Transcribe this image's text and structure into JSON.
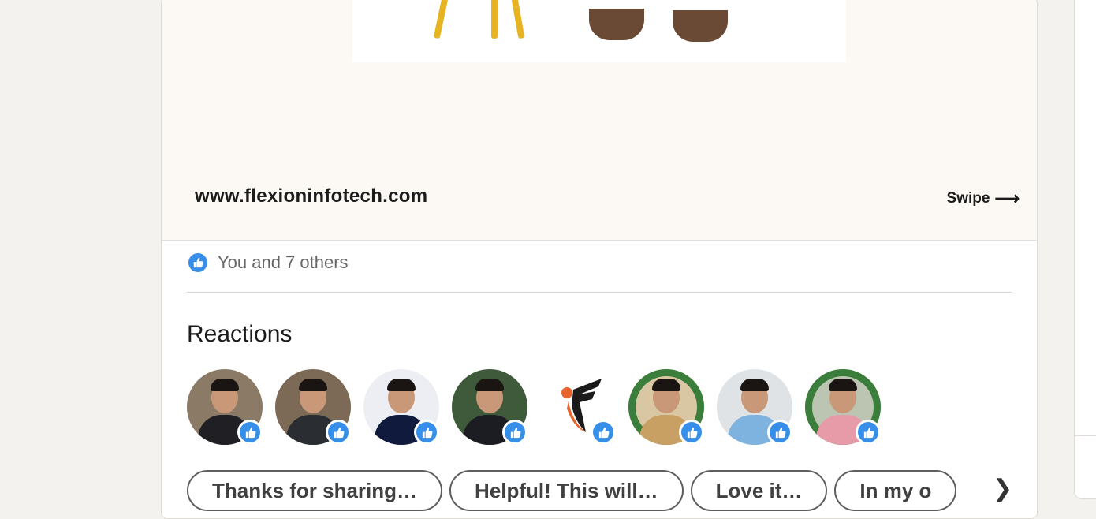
{
  "post": {
    "slide": {
      "website": "www.flexioninfotech.com",
      "swipe_label": "Swipe",
      "swipe_arrow": "⟶"
    },
    "social_counts": {
      "icon": "like-icon",
      "text": "You and 7 others"
    },
    "reactions": {
      "title": "Reactions",
      "reactors": [
        {
          "name": "reactor-1",
          "bg": "#8a7a66",
          "shirt": "#1f1f24",
          "badge": "like-icon"
        },
        {
          "name": "reactor-2",
          "bg": "#7c6a56",
          "shirt": "#2a2e33",
          "badge": "like-icon"
        },
        {
          "name": "reactor-3",
          "bg": "#eceef4",
          "shirt": "#101a3c",
          "badge": "like-icon"
        },
        {
          "name": "reactor-4",
          "bg": "#3e5a3a",
          "shirt": "#1c1d22",
          "badge": "like-icon"
        },
        {
          "name": "reactor-5-company-logo",
          "bg": "#ffffff",
          "shirt": "#ffffff",
          "badge": "like-icon"
        },
        {
          "name": "reactor-6-opentowork",
          "bg": "#d9c7a4",
          "shirt": "#c9a063",
          "badge": "like-icon",
          "ring": "#3b7d3a"
        },
        {
          "name": "reactor-7",
          "bg": "#dfe3e6",
          "shirt": "#7fb3df",
          "badge": "like-icon"
        },
        {
          "name": "reactor-8-opentowork",
          "bg": "#bcc4b2",
          "shirt": "#e79aa8",
          "badge": "like-icon",
          "ring": "#3b7d3a"
        }
      ]
    },
    "suggestions": [
      "Thanks for sharing…",
      "Helpful! This will…",
      "Love it…",
      "In my o"
    ],
    "suggestions_next": "❯"
  }
}
